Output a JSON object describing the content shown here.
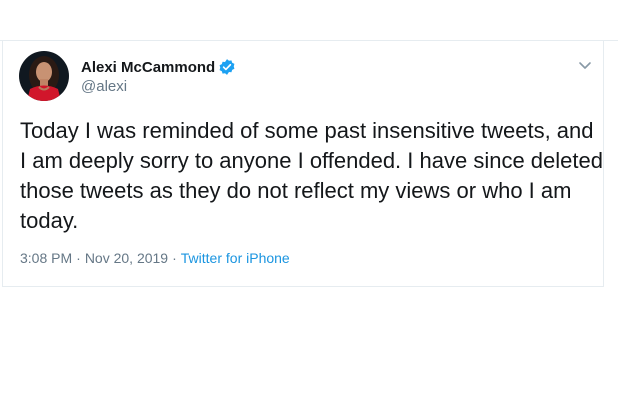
{
  "tweet": {
    "author": {
      "display_name": "Alexi McCammond",
      "handle": "@alexi",
      "verified": true
    },
    "text": "Today I was reminded of some past insensitive tweets, and I am deeply sorry to anyone I offended. I have since deleted those tweets as they do not reflect my views or who I am today.",
    "time": "3:08 PM",
    "separator": "·",
    "date": "Nov 20, 2019",
    "source": "Twitter for iPhone"
  },
  "colors": {
    "text_primary": "#14171a",
    "text_secondary": "#657786",
    "link": "#1b95e0",
    "verified_badge": "#1da1f2",
    "border": "#e6ecf0"
  },
  "icons": {
    "verified": "verified-badge-icon",
    "menu": "chevron-down-icon"
  }
}
